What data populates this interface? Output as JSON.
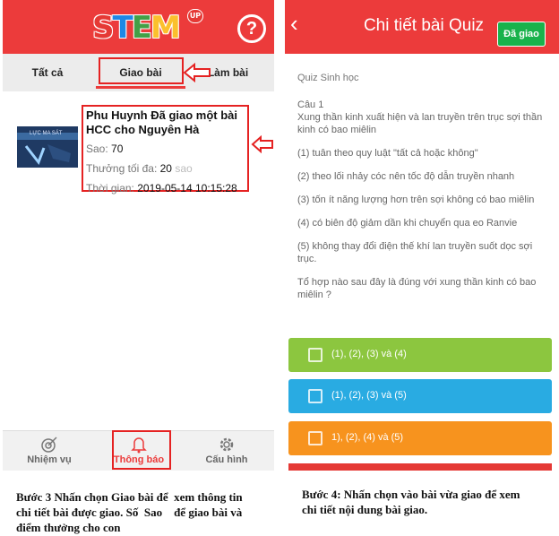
{
  "left": {
    "logo": {
      "letters": [
        "S",
        "T",
        "E",
        "M"
      ],
      "badge": "UP"
    },
    "help_icon": "question-circle-icon",
    "tabs": [
      {
        "label": "Tất cả"
      },
      {
        "label": "Giao bài"
      },
      {
        "label": "Làm bài"
      }
    ],
    "card": {
      "thumb_text": "LỰC MA SÁT",
      "title": "Phu Huynh Đã giao một bài HCC cho Nguyên Hà",
      "stars_label": "Sao:",
      "stars_value": "70",
      "max_points_label": "Thưởng tối đa:",
      "max_points_value": "20",
      "max_points_unit": "sao",
      "time_label": "Thời gian:",
      "time_value": "2019-05-14 10:15:28"
    },
    "nav": [
      {
        "label": "Nhiệm vụ",
        "icon": "target-icon"
      },
      {
        "label": "Thông báo",
        "icon": "bell-icon"
      },
      {
        "label": "Cấu hình",
        "icon": "gear-icon"
      }
    ]
  },
  "right": {
    "title": "Chi tiết bài Quiz",
    "status_button": "Đã giao",
    "subject": "Quiz Sinh học",
    "question_number": "Câu 1",
    "question": "Xung thần kinh xuất hiện và lan truyền trên trục sợi thần kinh có bao miêlin",
    "statements": [
      "(1) tuân theo quy luật \"tất cả hoặc không\"",
      "(2) theo lối nhảy cóc nên tốc độ dẫn truyền nhanh",
      "(3) tốn ít năng lượng hơn trên sợi không có bao miêlin",
      "(4) có biên độ giảm dần khi chuyển qua eo Ranvie",
      "(5) không thay đổi điện thế khí lan truyền suốt dọc sợi trục."
    ],
    "prompt": "Tổ hợp nào sau đây là đúng với xung thần kinh có bao miêlin ?",
    "options": [
      {
        "label": "(1), (2), (3) và (4)",
        "color": "#8cc63f"
      },
      {
        "label": "(1), (2), (3) và (5)",
        "color": "#29abe2"
      },
      {
        "label": "1), (2), (4) và (5)",
        "color": "#f7931e"
      }
    ]
  },
  "captions": {
    "left": "Bước 3 Nhấn chọn Giao bài để xem thông tin chi tiết bài được giao. Số Sao để giao bài và điểm thưởng cho con",
    "left_line1": "Bước 3 Nhấn chọn Giao bài để  xem thông tin",
    "left_line2": "chi tiết bài được giao. Số  Sao    để giao bài và",
    "left_line3": "điểm thưởng cho con",
    "right_line1": "Bước 4: Nhấn chọn vào bài vừa giao để xem",
    "right_line2": "chi tiết nội dung bài giao."
  },
  "colors": {
    "header": "#ec3b3b",
    "highlight": "#e52222",
    "done": "#19b24b"
  }
}
